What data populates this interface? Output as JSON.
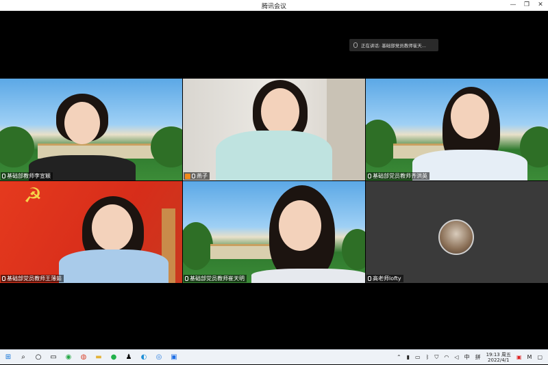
{
  "window": {
    "title": "腾讯会议",
    "controls": [
      "minimize",
      "restore",
      "close"
    ]
  },
  "speaking_banner": {
    "text": "正在讲话: 基础部党员教师崔天..."
  },
  "participants": [
    {
      "name": "基础部教师李宣颖",
      "bg": "gate"
    },
    {
      "name": "燕子",
      "bg": "room",
      "host": true
    },
    {
      "name": "基础部党员教师齐洪英",
      "bg": "gate"
    },
    {
      "name": "基础部党员教师王薄茹",
      "bg": "red"
    },
    {
      "name": "基础部党员教师崔天明",
      "bg": "gate"
    },
    {
      "name": "高老师lofty",
      "bg": "dark",
      "camera_off": true
    }
  ],
  "taskbar": {
    "apps": [
      "windows-start",
      "search",
      "cortana",
      "task-view",
      "app-green",
      "app-chrome",
      "file-explorer",
      "wechat",
      "qq",
      "edge",
      "browser",
      "tencent-meeting"
    ],
    "tray_ime": "中",
    "tray_pinyin": "拼",
    "time": "19:13 周五",
    "date": "2022/4/1"
  },
  "colors": {
    "accent": "#f08a1a",
    "taskbar": "#eef2f7"
  }
}
